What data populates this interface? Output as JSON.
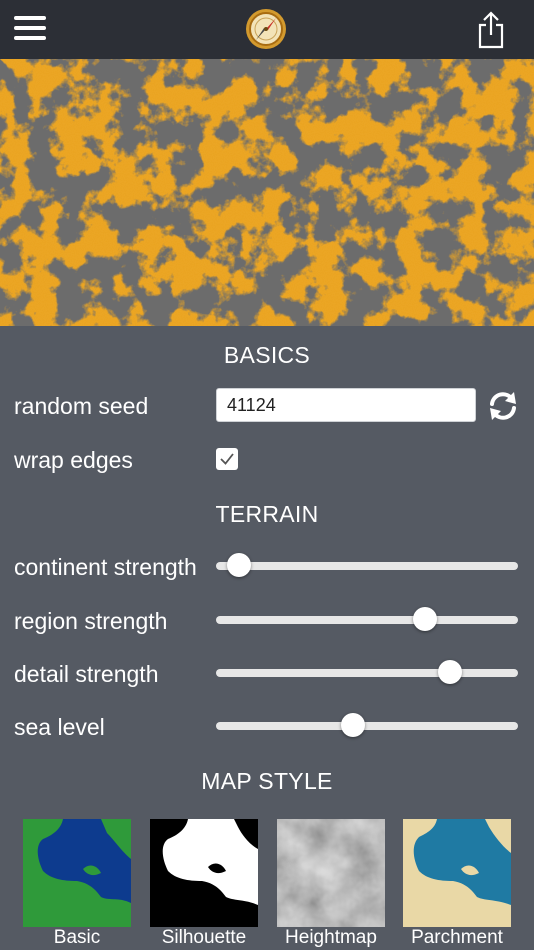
{
  "header": {
    "menu_icon": "hamburger-menu-icon",
    "logo_icon": "compass-icon",
    "share_icon": "share-icon"
  },
  "preview": {
    "land_color": "#e9a21c",
    "sea_color": "#262626"
  },
  "basics": {
    "title": "BASICS",
    "seed_label": "random seed",
    "seed_value": "41124",
    "refresh_icon": "refresh-icon",
    "wrap_label": "wrap edges",
    "wrap_checked": true
  },
  "terrain": {
    "title": "TERRAIN",
    "sliders": [
      {
        "label": "continent strength",
        "value": 0.04
      },
      {
        "label": "region strength",
        "value": 0.71
      },
      {
        "label": "detail strength",
        "value": 0.8
      },
      {
        "label": "sea level",
        "value": 0.45
      }
    ]
  },
  "map_style": {
    "title": "MAP STYLE",
    "options": [
      {
        "label": "Basic"
      },
      {
        "label": "Silhouette"
      },
      {
        "label": "Heightmap"
      },
      {
        "label": "Parchment"
      }
    ]
  },
  "colors": {
    "topbar": "#2c2f36",
    "panel": "#555a63",
    "basic_sea": "#0d3b8e",
    "basic_land": "#2f9a3a",
    "parchment_sea": "#1f7aa3",
    "parchment_land": "#e9d8a6"
  }
}
